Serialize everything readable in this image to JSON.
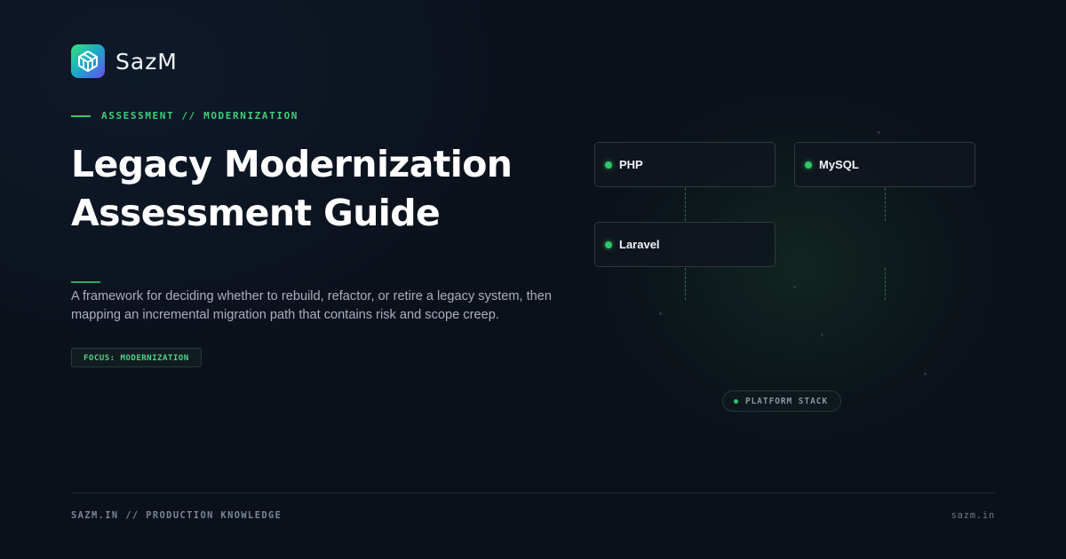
{
  "brand": {
    "name": "SazM",
    "logo_icon": "sazm-logo-icon"
  },
  "hero": {
    "eyebrow": "ASSESSMENT // MODERNIZATION",
    "title_line1": "Legacy Modernization",
    "title_line2": "Assessment Guide",
    "description": "A framework for deciding whether to rebuild, refactor, or retire a legacy system, then mapping an incremental migration path that contains risk and scope creep.",
    "focus_badge": "FOCUS: MODERNIZATION"
  },
  "diagram": {
    "nodes": [
      {
        "label": "PHP"
      },
      {
        "label": "MySQL"
      },
      {
        "label": "Laravel"
      }
    ],
    "stack_label": "PLATFORM STACK"
  },
  "footer": {
    "left_text": "SAZM.IN // PRODUCTION KNOWLEDGE",
    "right_text": "sazm.in"
  },
  "colors": {
    "background": "#0b111a",
    "accent_green": "#3fcf7a",
    "node_dot": "#2fc76a",
    "title_text": "#ffffff",
    "body_text": "#a7b0bd",
    "muted_text": "#7a8593"
  }
}
